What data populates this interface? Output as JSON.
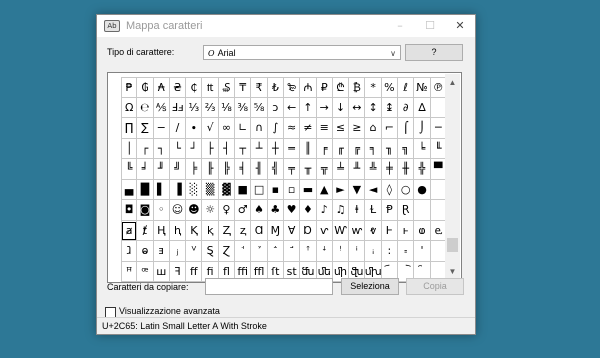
{
  "window": {
    "title": "Mappa caratteri",
    "app_icon": "charmap-icon",
    "controls": [
      "–",
      "☐",
      "✕"
    ]
  },
  "font_row": {
    "label": "Tipo di carattere:",
    "font_icon_glyph": "O",
    "font_value": "Arial",
    "help_label": "?"
  },
  "grid_scroll": {
    "up": "▲",
    "down": "▼"
  },
  "grid_rows": [
    [
      "₱",
      "₲",
      "₳",
      "₴",
      "₵",
      "₶",
      "₷",
      "₸",
      "₹",
      "₺",
      "₻",
      "₼",
      "₽",
      "₾",
      "₿",
      "*",
      "%",
      "ℓ",
      "№",
      "℗",
      "™"
    ],
    [
      "Ω",
      "℮",
      "⅍",
      "Ⅎⅎ",
      "⅓",
      "⅔",
      "⅛",
      "⅜",
      "⅝",
      "ↄ",
      "←",
      "↑",
      "→",
      "↓",
      "↔",
      "↕",
      "↨",
      "∂",
      "∆"
    ],
    [
      "∏",
      "∑",
      "−",
      "∕",
      "∙",
      "√",
      "∞",
      "∟",
      "∩",
      "∫",
      "≈",
      "≠",
      "≡",
      "≤",
      "≥",
      "⌂",
      "⌐",
      "⌠",
      "⌡",
      "─"
    ],
    [
      "│",
      "┌",
      "┐",
      "└",
      "┘",
      "├",
      "┤",
      "┬",
      "┴",
      "┼",
      "═",
      "║",
      "╒",
      "╓",
      "╔",
      "╕",
      "╖",
      "╗",
      "╘",
      "╙"
    ],
    [
      "╚",
      "╛",
      "╜",
      "╝",
      "╞",
      "╟",
      "╠",
      "╡",
      "╢",
      "╣",
      "╤",
      "╥",
      "╦",
      "╧",
      "╨",
      "╩",
      "╪",
      "╫",
      "╬",
      "▀"
    ],
    [
      "▄",
      "█",
      "▌",
      "▐",
      "░",
      "▒",
      "▓",
      "■",
      "□",
      "▪",
      "▫",
      "▬",
      "▲",
      "►",
      "▼",
      "◄",
      "◊",
      "○",
      "●"
    ],
    [
      "◘",
      "◙",
      "◦",
      "☺",
      "☻",
      "☼",
      "♀",
      "♂",
      "♠",
      "♣",
      "♥",
      "♦",
      "♪",
      "♫",
      "ⱡ",
      "Ɫ",
      "Ᵽ",
      "Ɽ"
    ],
    [
      "ⱥ",
      "ⱦ",
      "Ⱨ",
      "ⱨ",
      "Ⱪ",
      "ⱪ",
      "Ⱬ",
      "ⱬ",
      "Ɑ",
      "Ɱ",
      "Ɐ",
      "Ɒ",
      "ⱱ",
      "Ⱳ",
      "ⱳ",
      "ⱴ",
      "Ⱶ",
      "ⱶ",
      "ⱷ",
      "ⱸ"
    ],
    [
      "ⱹ",
      "ⱺ",
      "ⱻ",
      "ⱼ",
      "ⱽ",
      "Ȿ",
      "Ɀ",
      "ꜗ",
      "ꜘ",
      "ꜙ",
      "ꜚ",
      "ꜛ",
      "ꜜ",
      "ꜝ",
      "ꜞ",
      "ꜟ",
      "꞉",
      "꞊",
      "ꞌ"
    ],
    [
      "ꟸ",
      "ꟹ",
      "ꟺ",
      "ꟻ",
      "ff",
      "fi",
      "fl",
      "ffi",
      "ffl",
      "ſt",
      "st",
      "ﬓ",
      "ﬔ",
      "ﬕ",
      "ﬖ",
      "ﬗ",
      "︠",
      "︡",
      "︢"
    ]
  ],
  "copy_row": {
    "label": "Caratteri da copiare:",
    "value": "",
    "select_label": "Seleziona",
    "copy_label": "Copia"
  },
  "advanced_view": {
    "label": "Visualizzazione avanzata",
    "checked": false
  },
  "status": {
    "text": "U+2C65: Latin Small Letter A With Stroke"
  }
}
